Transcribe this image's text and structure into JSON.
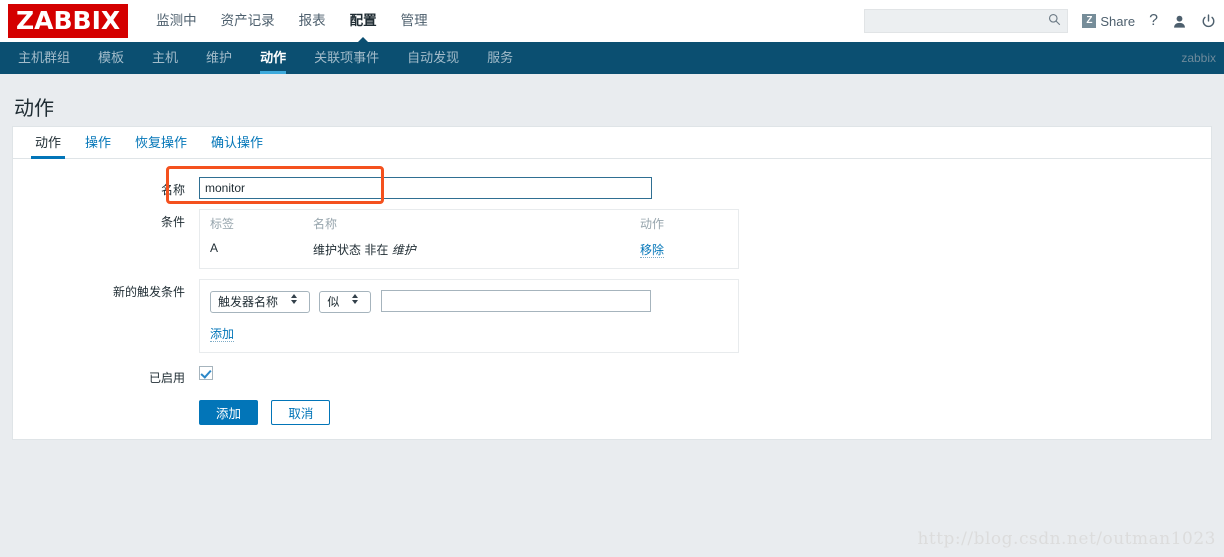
{
  "header": {
    "logo_text": "ZABBIX",
    "main_menu": [
      {
        "label": "监测中",
        "selected": false
      },
      {
        "label": "资产记录",
        "selected": false
      },
      {
        "label": "报表",
        "selected": false
      },
      {
        "label": "配置",
        "selected": true
      },
      {
        "label": "管理",
        "selected": false
      }
    ],
    "search": {
      "value": "",
      "placeholder": ""
    },
    "share_label": "Share",
    "share_badge": "Z",
    "help_label": "?",
    "icons": {
      "search": "search-icon",
      "user": "user-icon",
      "logout": "power-icon"
    }
  },
  "subnav": {
    "items": [
      {
        "label": "主机群组",
        "selected": false
      },
      {
        "label": "模板",
        "selected": false
      },
      {
        "label": "主机",
        "selected": false
      },
      {
        "label": "维护",
        "selected": false
      },
      {
        "label": "动作",
        "selected": true
      },
      {
        "label": "关联项事件",
        "selected": false
      },
      {
        "label": "自动发现",
        "selected": false
      },
      {
        "label": "服务",
        "selected": false
      }
    ],
    "user_label": "zabbix"
  },
  "page": {
    "title": "动作"
  },
  "tabs": [
    {
      "label": "动作",
      "selected": true
    },
    {
      "label": "操作",
      "selected": false
    },
    {
      "label": "恢复操作",
      "selected": false
    },
    {
      "label": "确认操作",
      "selected": false
    }
  ],
  "form": {
    "name": {
      "label": "名称",
      "value": "monitor",
      "placeholder": ""
    },
    "conditions": {
      "label": "条件",
      "columns": [
        "标签",
        "名称",
        "动作"
      ],
      "rows": [
        {
          "tag": "A",
          "name_prefix": "维护状态 非在",
          "name_italic": "维护",
          "action": "移除"
        }
      ]
    },
    "new_condition": {
      "label": "新的触发条件",
      "type_select": {
        "value": "触发器名称",
        "options": [
          "触发器名称"
        ]
      },
      "operator_select": {
        "value": "似",
        "options": [
          "似"
        ]
      },
      "value_input": {
        "value": "",
        "placeholder": ""
      },
      "add_link": "添加"
    },
    "enabled": {
      "label": "已启用",
      "checked": true
    },
    "buttons": {
      "submit": "添加",
      "cancel": "取消"
    }
  },
  "watermark": "http://blog.csdn.net/outman1023",
  "colors": {
    "logo_red": "#d40000",
    "nav_blue": "#0b4f71",
    "accent_blue": "#0275b8",
    "annotation_red": "#f4511e"
  }
}
